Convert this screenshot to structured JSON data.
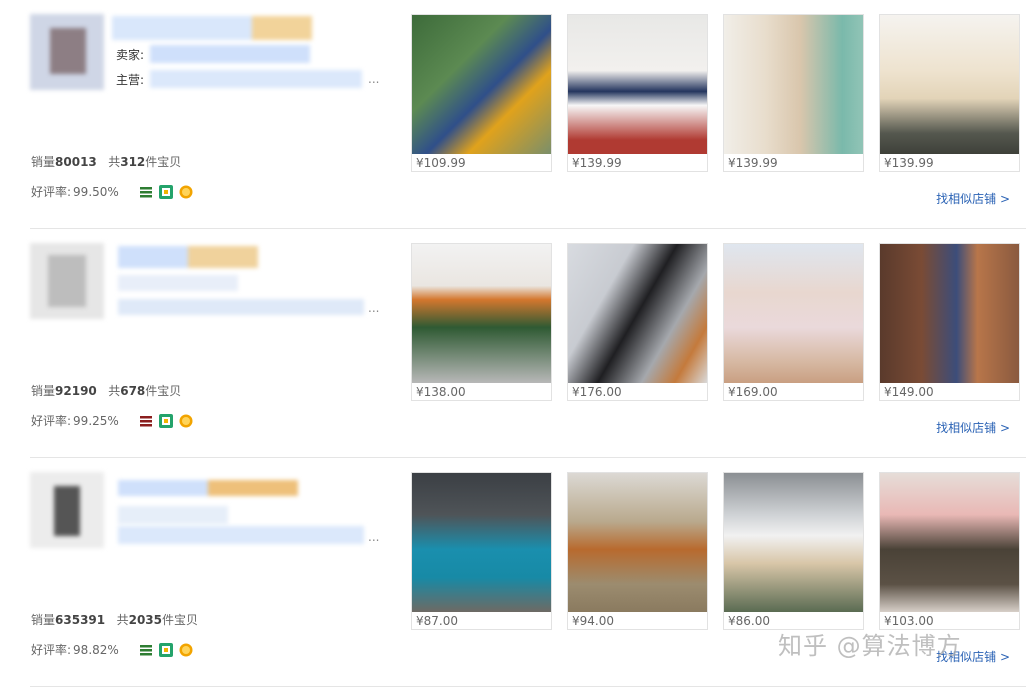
{
  "rows": [
    {
      "seller_label": "卖家:",
      "main_label": "主营:",
      "ellipsis": "...",
      "sales_label": "销量",
      "sales_value": "80013",
      "total_prefix": "共",
      "total_value": "312",
      "total_suffix": "件宝贝",
      "rating_label": "好评率:",
      "rating_value": "99.50%",
      "similar_label": "找相似店铺 >",
      "products": [
        {
          "price": "¥109.99",
          "desc": "woman in blue varsity jacket with yellow hoodie"
        },
        {
          "price": "¥139.99",
          "desc": "woman in white and navy jacket"
        },
        {
          "price": "¥139.99",
          "desc": "woman in cream jacket with red trim"
        },
        {
          "price": "¥139.99",
          "desc": "person in beige and grey hooded jacket"
        }
      ]
    },
    {
      "seller_label": "",
      "main_label": "",
      "ellipsis": "...",
      "sales_label": "销量",
      "sales_value": "92190",
      "total_prefix": "共",
      "total_value": "678",
      "total_suffix": "件宝贝",
      "rating_label": "好评率:",
      "rating_value": "99.25%",
      "similar_label": "找相似店铺 >",
      "products": [
        {
          "price": "¥138.00",
          "desc": "woman in green jacket with orange beanie"
        },
        {
          "price": "¥176.00",
          "desc": "two women in black and grey puffer jackets on stairs"
        },
        {
          "price": "¥169.00",
          "desc": "woman in pink coat"
        },
        {
          "price": "¥149.00",
          "desc": "woman in blue jacket among dolls"
        }
      ]
    },
    {
      "seller_label": "",
      "main_label": "",
      "ellipsis": "...",
      "sales_label": "销量",
      "sales_value": "635391",
      "total_prefix": "共",
      "total_value": "2035",
      "total_suffix": "件宝贝",
      "rating_label": "好评率:",
      "rating_value": "98.82%",
      "similar_label": "找相似店铺 >",
      "products": [
        {
          "price": "¥87.00",
          "desc": "woman in teal puffer jacket"
        },
        {
          "price": "¥94.00",
          "desc": "woman in brown puffer jacket in reeds"
        },
        {
          "price": "¥86.00",
          "desc": "woman in beige puffer jacket by white car"
        },
        {
          "price": "¥103.00",
          "desc": "woman in pink hooded jacket"
        }
      ]
    }
  ],
  "watermark": "知乎 @算法博方",
  "colors": {
    "link": "#2b63b5",
    "price": "#666666",
    "divider": "#e5e5e5"
  }
}
